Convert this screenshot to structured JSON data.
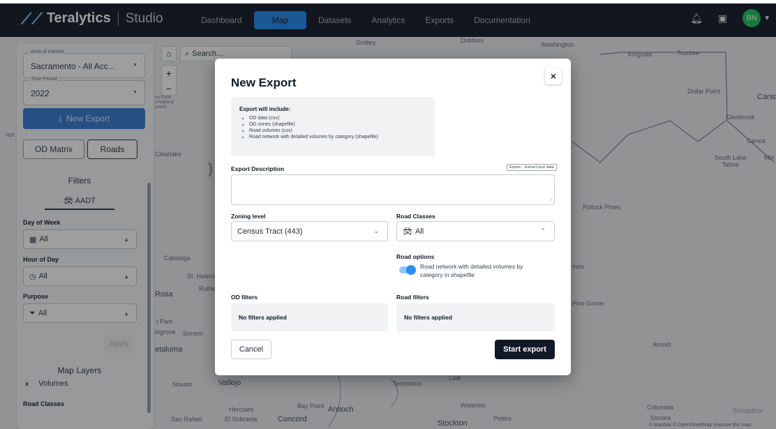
{
  "nav": {
    "brand": "Teralytics",
    "product": "Studio",
    "tabs": [
      "Dashboard",
      "Map",
      "Datasets",
      "Analytics",
      "Exports",
      "Documentation"
    ],
    "active_tab": "Map",
    "avatar_initials": "BN"
  },
  "map": {
    "search_placeholder": "Search...",
    "labels": {
      "gridley": "Gridley",
      "dobbins": "Dobbins",
      "washington": "Washington",
      "kingvale": "Kingvale",
      "truckee": "Truckee",
      "dollar_point": "Dollar Point",
      "carson": "Carso",
      "glenbrook": "Glenbrook",
      "genoa": "Genoa",
      "south_lake_tahoe": "South Lake\nTahoe",
      "minden": "Min",
      "clearlake": "Clearlake",
      "pollock_pines": "Pollock Pines",
      "calistoga": "Calistoga",
      "st_helena": "St. Helena",
      "rutherford": "Ruther",
      "santa_rosa": "Rosa",
      "park": "t Park",
      "rohnert": "ingrove",
      "sonoma": "Sonom",
      "petaluma": "etaluma",
      "novato": "Novato",
      "vallejo": "Vallejo",
      "san_rafael": "San Rafael",
      "el_sobrante": "El Sobrante",
      "hercules": "Hercules",
      "concord": "Concord",
      "bay_point": "Bay Point",
      "antioch": "Antioch",
      "terminous": "Terminous",
      "lodi": "Lodi",
      "waterloo": "Waterloo",
      "stockton": "Stockton",
      "peters": "Peters",
      "columbia": "Columbia",
      "sonora": "Sonora",
      "arnold": "Arnold",
      "pine_grove": "Pine Grove",
      "pines": "ines",
      "national": "na Snow\nn National\nument",
      "attribution": "© Mapbox © OpenStreetMap  Improve this map",
      "mapbox": "©mapbox",
      "nor": "nor"
    }
  },
  "sidebar": {
    "area_label": "Area of interest",
    "area_value": "Sacramento - All Acc...",
    "period_label": "Time Period",
    "period_value": "2022",
    "new_export": "New Export",
    "seg_od": "OD Matrix",
    "seg_roads": "Roads",
    "filters_title": "Filters",
    "aadt": "AADT",
    "day_label": "Day of Week",
    "day_value": "All",
    "hour_label": "Hour of Day",
    "hour_value": "All",
    "purpose_label": "Purpose",
    "purpose_value": "All",
    "apply": "Apply",
    "layers_title": "Map Layers",
    "volumes": "Volumes",
    "road_classes": "Road Classes"
  },
  "modal": {
    "title": "New Export",
    "close": "×",
    "include_title": "Export will include:",
    "include_items": [
      "OD data (csv)",
      "OD zones (shapefile)",
      "Road volumes (csv)",
      "Road network with detailed volumes by category (shapefile)"
    ],
    "tooltip": "Export – Extract your data",
    "description_label": "Export Description",
    "description_value": "",
    "zoning_label": "Zoning level",
    "zoning_value": "Census Tract (443)",
    "road_classes_label": "Road Classes",
    "road_classes_value": "All",
    "road_options_label": "Road options",
    "road_option_text": "Road network with detailed volumes by category in shapefile",
    "road_option_enabled": true,
    "od_filters_label": "OD filters",
    "od_filters_value": "No filters applied",
    "road_filters_label": "Road filters",
    "road_filters_value": "No filters applied",
    "cancel": "Cancel",
    "start": "Start export"
  }
}
